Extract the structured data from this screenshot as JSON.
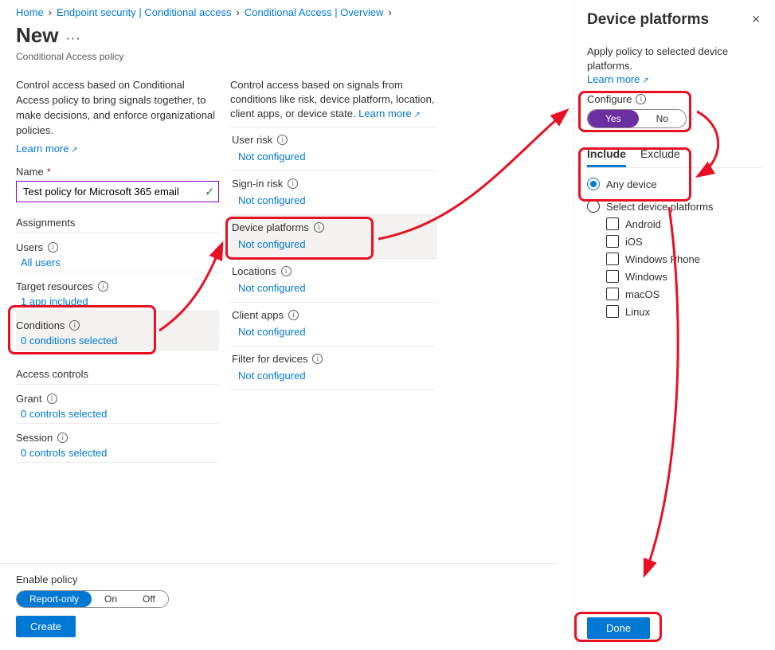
{
  "breadcrumb": {
    "home": "Home",
    "l1": "Endpoint security | Conditional access",
    "l2": "Conditional Access | Overview"
  },
  "page": {
    "title": "New",
    "subtitle": "Conditional Access policy"
  },
  "left": {
    "intro": "Control access based on Conditional Access policy to bring signals together, to make decisions, and enforce organizational policies.",
    "learn_more": "Learn more",
    "name_label": "Name",
    "name_value": "Test policy for Microsoft 365 email",
    "assignments_heading": "Assignments",
    "users_label": "Users",
    "users_link": "All users",
    "target_label": "Target resources",
    "target_link": "1 app included",
    "conditions_label": "Conditions",
    "conditions_link": "0 conditions selected",
    "access_heading": "Access controls",
    "grant_label": "Grant",
    "grant_link": "0 controls selected",
    "session_label": "Session",
    "session_link": "0 controls selected"
  },
  "mid": {
    "intro": "Control access based on signals from conditions like risk, device platform, location, client apps, or device state.",
    "learn_more": "Learn more",
    "not_configured": "Not configured",
    "items": [
      {
        "label": "User risk"
      },
      {
        "label": "Sign-in risk"
      },
      {
        "label": "Device platforms"
      },
      {
        "label": "Locations"
      },
      {
        "label": "Client apps"
      },
      {
        "label": "Filter for devices"
      }
    ]
  },
  "bottom": {
    "enable_label": "Enable policy",
    "opt_report": "Report-only",
    "opt_on": "On",
    "opt_off": "Off",
    "create": "Create"
  },
  "panel": {
    "title": "Device platforms",
    "intro": "Apply policy to selected device platforms.",
    "learn_more": "Learn more",
    "configure_label": "Configure",
    "yes": "Yes",
    "no": "No",
    "tab_include": "Include",
    "tab_exclude": "Exclude",
    "opt_any": "Any device",
    "opt_select": "Select device platforms",
    "platforms": [
      "Android",
      "iOS",
      "Windows Phone",
      "Windows",
      "macOS",
      "Linux"
    ],
    "done": "Done"
  }
}
